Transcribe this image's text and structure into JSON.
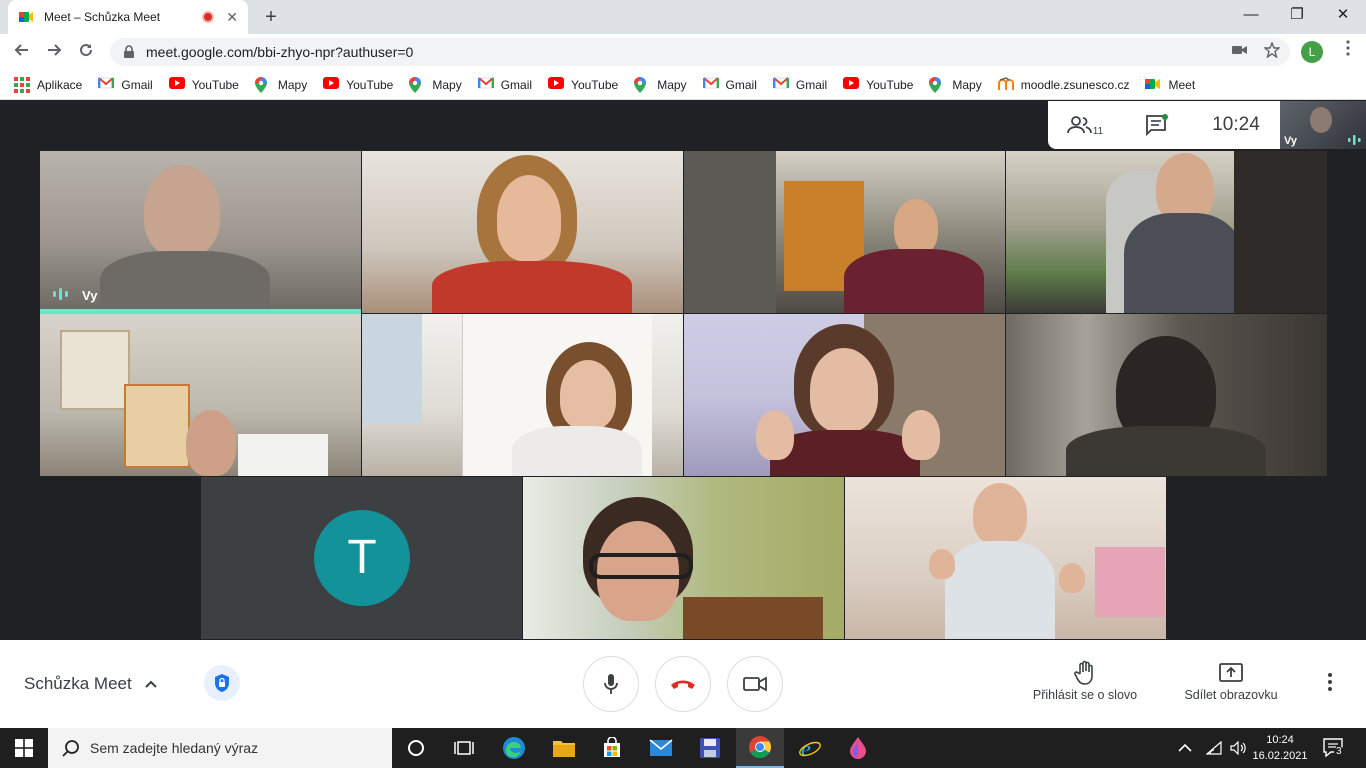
{
  "browser": {
    "tab_title": "Meet – Schůzka Meet",
    "tab_close": "✕",
    "new_tab": "+",
    "win_minimize": "—",
    "win_restore": "❐",
    "win_close": "✕",
    "url": "meet.google.com/bbi-zhyo-npr?authuser=0",
    "profile_initial": "L",
    "bookmarks": [
      {
        "label": "Aplikace",
        "icon": "apps-grid-icon"
      },
      {
        "label": "Gmail",
        "icon": "gmail-icon"
      },
      {
        "label": "YouTube",
        "icon": "youtube-icon"
      },
      {
        "label": "Mapy",
        "icon": "maps-icon"
      },
      {
        "label": "YouTube",
        "icon": "youtube-icon"
      },
      {
        "label": "Mapy",
        "icon": "maps-icon"
      },
      {
        "label": "Gmail",
        "icon": "gmail-icon"
      },
      {
        "label": "YouTube",
        "icon": "youtube-icon"
      },
      {
        "label": "Mapy",
        "icon": "maps-icon"
      },
      {
        "label": "Gmail",
        "icon": "gmail-icon"
      },
      {
        "label": "Gmail",
        "icon": "gmail-icon"
      },
      {
        "label": "YouTube",
        "icon": "youtube-icon"
      },
      {
        "label": "Mapy",
        "icon": "maps-icon"
      },
      {
        "label": "moodle.zsunesco.cz",
        "icon": "moodle-icon"
      },
      {
        "label": "Meet",
        "icon": "meet-icon"
      }
    ]
  },
  "meet": {
    "participant_count": "11",
    "time": "10:24",
    "self_label": "Vy",
    "tile_self_name": "Vy",
    "avatar_initial": "T",
    "meeting_title": "Schůzka Meet",
    "raise_hand_label": "Přihlásit se o slovo",
    "present_label": "Sdílet obrazovku"
  },
  "taskbar": {
    "search_placeholder": "Sem zadejte hledaný výraz",
    "clock_time": "10:24",
    "clock_date": "16.02.2021",
    "notification_count": "3"
  },
  "colors": {
    "accent_speaking": "#6fe3c8",
    "avatar_bg": "#12939a",
    "hangup": "#d93025"
  }
}
